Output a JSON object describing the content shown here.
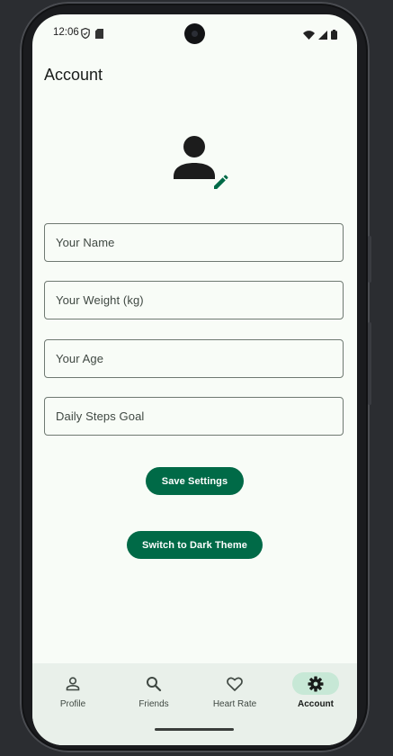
{
  "status_bar": {
    "time": "12:06",
    "left_icons": [
      "shield-icon",
      "sim-card-icon"
    ],
    "right_icons": [
      "wifi-icon",
      "signal-icon",
      "battery-icon"
    ]
  },
  "header": {
    "title": "Account"
  },
  "profile": {
    "avatar_icon": "person-icon",
    "edit_icon": "pencil-icon"
  },
  "form": {
    "fields": [
      {
        "label": "Your Name",
        "value": ""
      },
      {
        "label": "Your Weight (kg)",
        "value": ""
      },
      {
        "label": "Your Age",
        "value": ""
      },
      {
        "label": "Daily Steps Goal",
        "value": ""
      }
    ],
    "save_label": "Save Settings",
    "theme_label": "Switch to Dark Theme"
  },
  "bottom_nav": {
    "items": [
      {
        "label": "Profile",
        "icon": "person-outline-icon"
      },
      {
        "label": "Friends",
        "icon": "search-icon"
      },
      {
        "label": "Heart Rate",
        "icon": "heart-icon"
      },
      {
        "label": "Account",
        "icon": "gear-icon",
        "active": true
      }
    ]
  },
  "colors": {
    "primary": "#006a47",
    "background": "#f8fcf7",
    "nav_background": "#e9f0ea",
    "active_indicator": "#c7e8d6"
  }
}
